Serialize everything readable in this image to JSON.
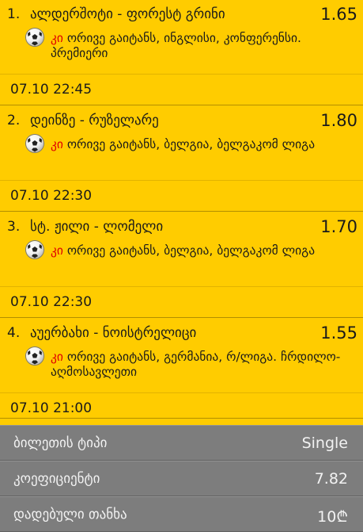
{
  "bets": [
    {
      "num": "1.",
      "match": "ალდერშოტი - ფორესტ გრინი",
      "odd": "1.65",
      "tag": "კი",
      "desc": "ორივე გაიტანს, ინგლისი, კონფერენსი. პრემიერი",
      "time": "07.10 22:45",
      "icon": "soccer-ball-icon"
    },
    {
      "num": "2.",
      "match": "დეინზე - რუზელარე",
      "odd": "1.80",
      "tag": "კი",
      "desc": "ორივე გაიტანს, ბელგია, ბელგაკომ ლიგა",
      "time": "07.10 22:30",
      "icon": "soccer-ball-icon"
    },
    {
      "num": "3.",
      "match": "სტ. ჟილი - ლომელი",
      "odd": "1.70",
      "tag": "კი",
      "desc": "ორივე გაიტანს, ბელგია, ბელგაკომ ლიგა",
      "time": "07.10 22:30",
      "icon": "soccer-ball-icon"
    },
    {
      "num": "4.",
      "match": "აუერბახი - ნოისტრელიცი",
      "odd": "1.55",
      "tag": "კი",
      "desc": "ორივე გაიტანს, გერმანია, რ/ლიგა. ჩრდილო-აღმოსავლეთი",
      "time": "07.10 21:00",
      "icon": "soccer-ball-icon"
    }
  ],
  "summary": {
    "ticket_type_label": "ბილეთის ტიპი",
    "ticket_type_value": "Single",
    "coef_label": "კოეფიციენტი",
    "coef_value": "7.82",
    "stake_label": "დადებული თანხა",
    "stake_value": "10₾"
  },
  "colors": {
    "accent": "#ffcc00",
    "summary_bg": "#7d7d7d",
    "tag": "#e00000"
  }
}
